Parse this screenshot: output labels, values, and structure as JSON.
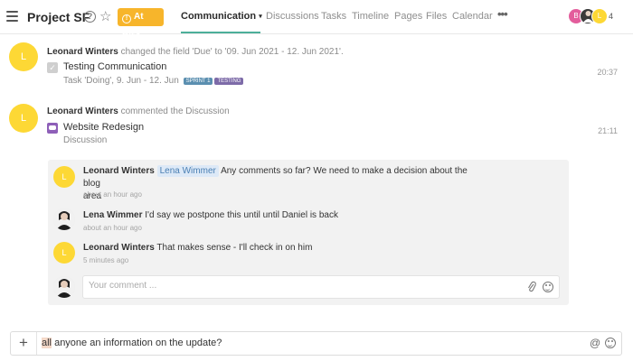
{
  "header": {
    "project_title": "Project SF",
    "help_glyph": "?",
    "status_badge": "At Risk",
    "status_color": "#f7b52b",
    "nav": [
      {
        "label": "Communication",
        "active": true
      },
      {
        "label": "Discussions"
      },
      {
        "label": "Tasks"
      },
      {
        "label": "Timeline"
      },
      {
        "label": "Pages"
      },
      {
        "label": "Files"
      },
      {
        "label": "Calendar"
      }
    ],
    "more_glyph": "•••",
    "members_count": "4",
    "member_initials": [
      "B",
      "L"
    ]
  },
  "activities": [
    {
      "author": "Leonard Winters",
      "action": "changed the field 'Due' to '09. Jun 2021 - 12. Jun 2021'.",
      "item_title": "Testing Communication",
      "item_sub": "Task 'Doing', 9. Jun - 12. Jun",
      "tags": [
        {
          "label": "SPRINT 1",
          "color": "#5b8fb0"
        },
        {
          "label": "TESTING",
          "color": "#7d6ba8"
        }
      ],
      "time": "20:37",
      "avatar_initial": "L"
    },
    {
      "author": "Leonard Winters",
      "action": "commented the Discussion",
      "item_title": "Website Redesign",
      "item_sub": "Discussion",
      "time": "21:11",
      "avatar_initial": "L"
    }
  ],
  "comments": [
    {
      "author": "Leonard Winters",
      "mention": "Lena Wimmer",
      "text_line1": "Any comments so far? We need to make a decision about the blog",
      "text_line2": "area",
      "time": "about an hour ago",
      "avatar_initial": "L"
    },
    {
      "author": "Lena Wimmer",
      "text": "I'd say we postpone this until until Daniel is back",
      "time": "about an hour ago"
    },
    {
      "author": "Leonard Winters",
      "text": "That makes sense - I'll check in on him",
      "time": "5 minutes ago",
      "avatar_initial": "L"
    }
  ],
  "comment_input": {
    "placeholder": "Your comment ..."
  },
  "reply_bar": {
    "plus": "+",
    "highlighted": "all",
    "text": " anyone an information on the update?",
    "at": "@"
  },
  "colors": {
    "accent": "#4caf9a",
    "avatar_yellow": "#fdd835",
    "discussion_icon": "#8e5fb8"
  }
}
